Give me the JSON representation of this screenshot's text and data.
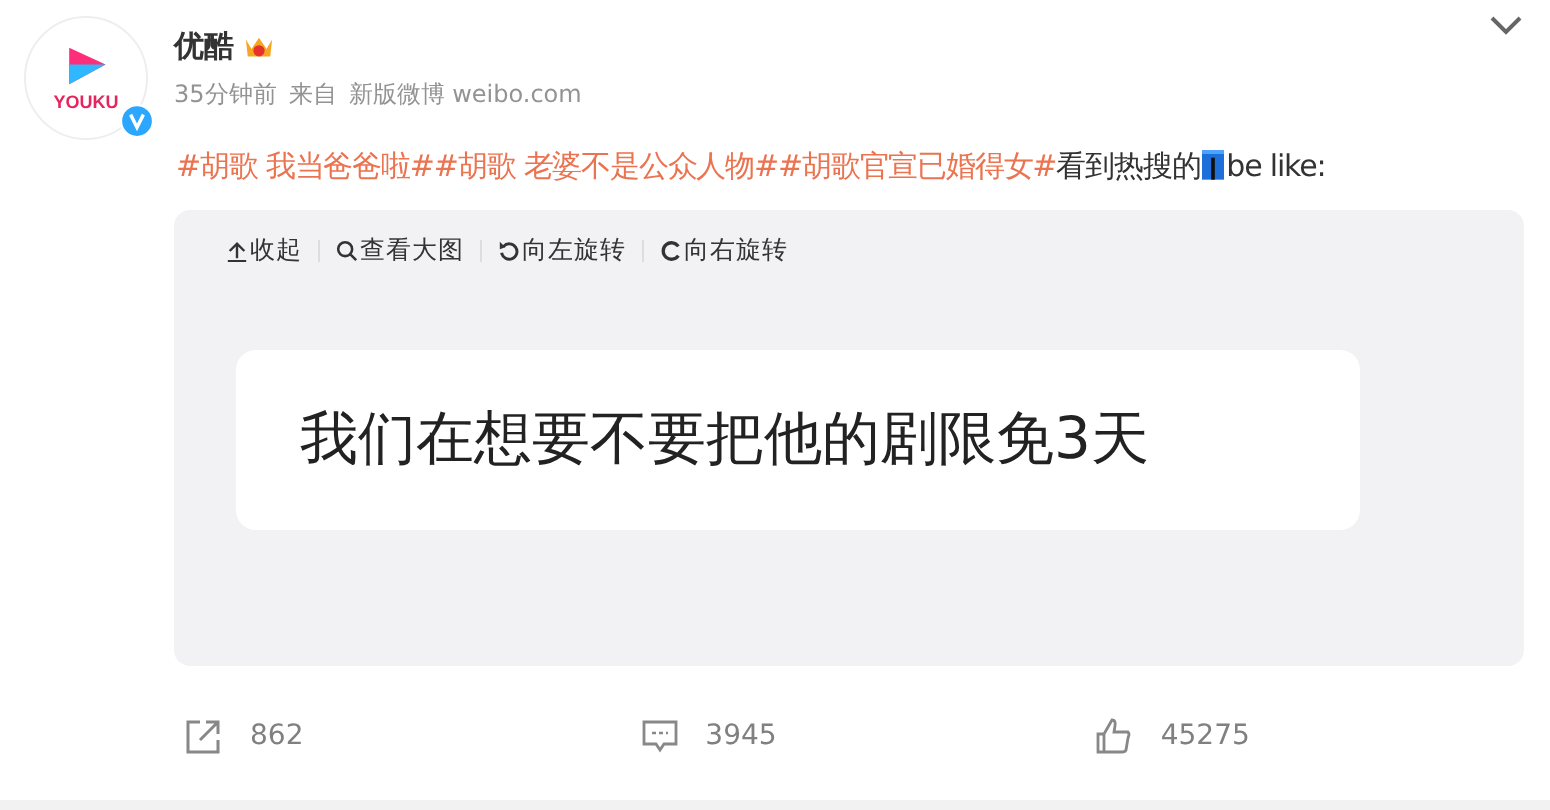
{
  "author": {
    "name": "优酷",
    "avatar_text": "YOUKU",
    "verified": true,
    "crown": true
  },
  "meta": {
    "time": "35分钟前",
    "source_prefix": "来自",
    "source": "新版微博 weibo.com"
  },
  "post": {
    "segments": [
      {
        "kind": "hashtag",
        "text": "#胡歌 我当爸爸啦#"
      },
      {
        "kind": "hashtag",
        "text": "#胡歌 老婆不是公众人物#"
      },
      {
        "kind": "hashtag",
        "text": "#胡歌官宣已婚得女#"
      },
      {
        "kind": "text",
        "text": "看到热搜的"
      },
      {
        "kind": "emoji"
      },
      {
        "kind": "text",
        "text": "be like:"
      }
    ]
  },
  "image_toolbar": [
    {
      "kind": "collapse",
      "label": "收起"
    },
    {
      "kind": "zoom",
      "label": "查看大图"
    },
    {
      "kind": "rotate_left",
      "label": "向左旋转"
    },
    {
      "kind": "rotate_right",
      "label": "向右旋转"
    }
  ],
  "image_caption": "我们在想要不要把他的剧限免3天",
  "actions": [
    {
      "kind": "share",
      "count": "862"
    },
    {
      "kind": "comment",
      "count": "3945"
    },
    {
      "kind": "like",
      "count": "45275"
    }
  ]
}
